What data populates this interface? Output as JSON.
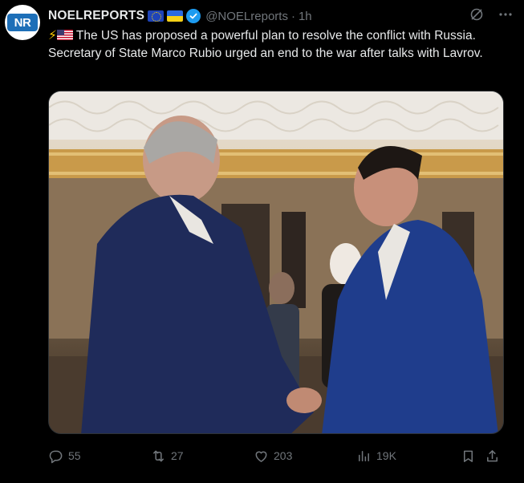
{
  "author": {
    "avatar_text": "NR",
    "display_name": "NOELREPORTS",
    "handle": "@NOELreports",
    "separator": "·",
    "time": "1h"
  },
  "tweet": {
    "emoji": "⚡",
    "text": "The US has proposed a powerful plan to resolve the conflict with Russia. Secretary of State Marco Rubio urged an end to the war after talks with Lavrov."
  },
  "metrics": {
    "replies": "55",
    "retweets": "27",
    "likes": "203",
    "views": "19K"
  },
  "colors": {
    "background": "#000000",
    "text": "#e7e9ea",
    "muted": "#71767b",
    "verified": "#1d9bf0"
  },
  "icons": [
    "grok-icon",
    "more-icon",
    "reply-icon",
    "retweet-icon",
    "like-icon",
    "views-icon",
    "bookmark-icon",
    "share-icon"
  ]
}
